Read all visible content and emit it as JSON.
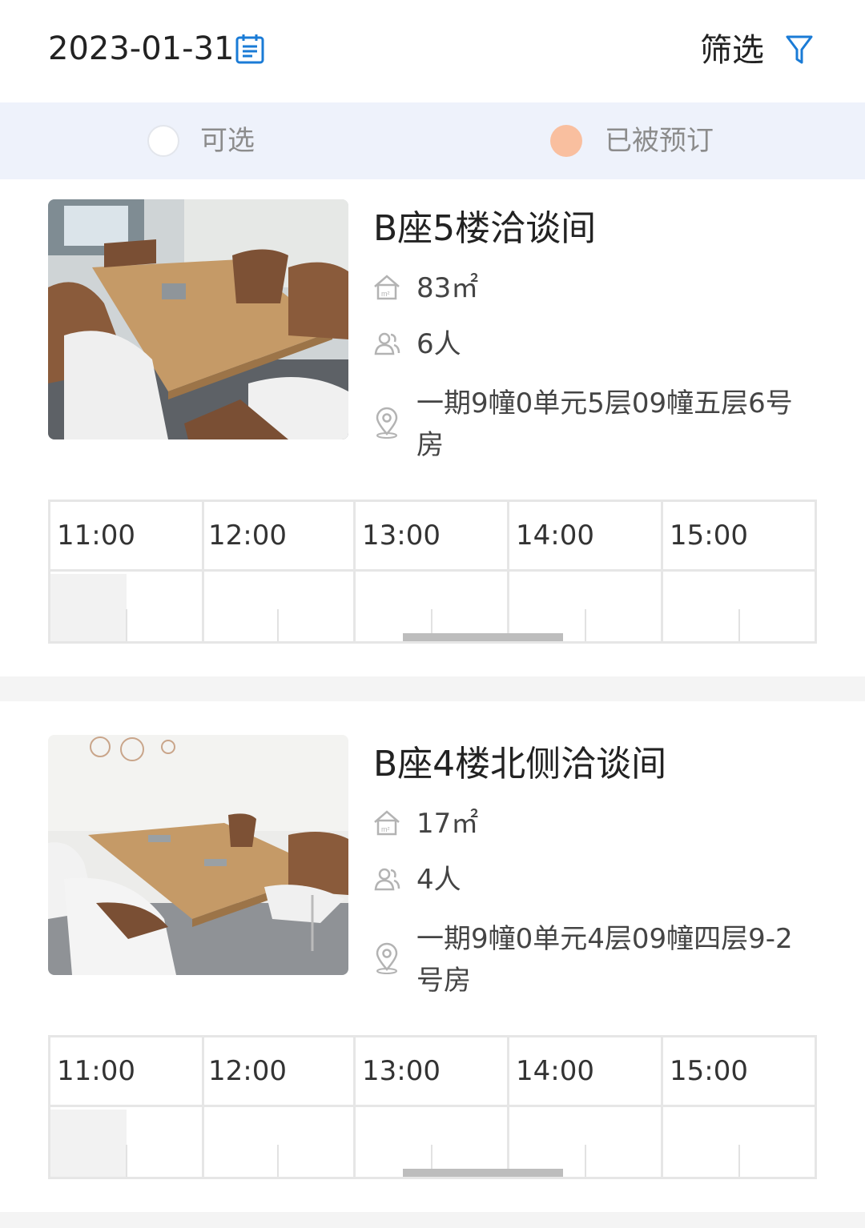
{
  "header": {
    "date": "2023-01-31",
    "filter_label": "筛选"
  },
  "legend": {
    "free_label": "可选",
    "booked_label": "已被预订",
    "booked_color": "#f9bf9f"
  },
  "rooms": [
    {
      "name": "B座5楼洽谈间",
      "area": "83㎡",
      "capacity": "6人",
      "address": "一期9幢0单元5层09幢五层6号房",
      "times": [
        "11:00",
        "12:00",
        "13:00",
        "14:00",
        "15:00"
      ]
    },
    {
      "name": "B座4楼北侧洽谈间",
      "area": "17㎡",
      "capacity": "4人",
      "address": "一期9幢0单元4层09幢四层9-2号房",
      "times": [
        "11:00",
        "12:00",
        "13:00",
        "14:00",
        "15:00"
      ]
    }
  ],
  "icons": {
    "calendar": "calendar-icon",
    "filter": "filter-icon",
    "area": "area-icon",
    "capacity": "people-icon",
    "location": "location-icon"
  },
  "accent_color": "#1a7bd6"
}
